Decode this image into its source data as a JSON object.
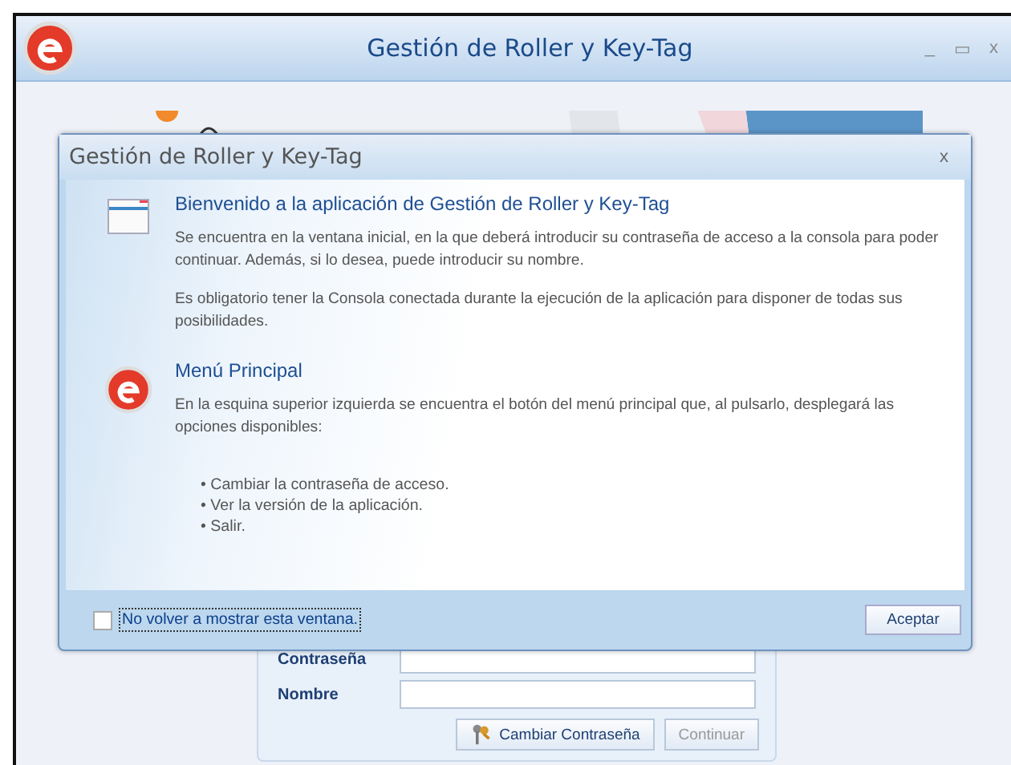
{
  "window": {
    "title": "Gestión de Roller y Key-Tag",
    "controls": [
      "_",
      "▭",
      "x"
    ]
  },
  "form": {
    "fields": [
      {
        "label": "Contraseña"
      },
      {
        "label": "Nombre"
      }
    ],
    "buttons": [
      {
        "kind": "key",
        "label": "Cambiar Contraseña",
        "disabled": false
      },
      {
        "kind": "plain",
        "label": "Continuar",
        "disabled": true
      }
    ]
  },
  "dialog": {
    "title": "Gestión de Roller y Key-Tag",
    "close": "x",
    "sections": [
      {
        "kind": "window",
        "heading": "Bienvenido a la aplicación de Gestión de Roller y Key-Tag",
        "paragraphs": [
          "Se encuentra en la ventana inicial, en la que deberá introducir su contraseña de acceso a la consola para poder continuar. Además, si lo desea, puede introducir su nombre.",
          "Es obligatorio tener la Consola conectada durante la ejecución de la aplicación para disponer de todas sus posibilidades."
        ]
      },
      {
        "kind": "logo",
        "heading": "Menú Principal",
        "paragraphs": [
          "En la esquina superior izquierda se encuentra el botón del menú principal que, al pulsarlo, desplegará las opciones disponibles:"
        ],
        "bullets": [
          "• Cambiar la contraseña de acceso.",
          "• Ver la versión de la aplicación.",
          "• Salir."
        ]
      }
    ],
    "checkbox": {
      "label": "No volver a mostrar esta ventana.",
      "checked": false
    },
    "ok_button": "Aceptar"
  }
}
